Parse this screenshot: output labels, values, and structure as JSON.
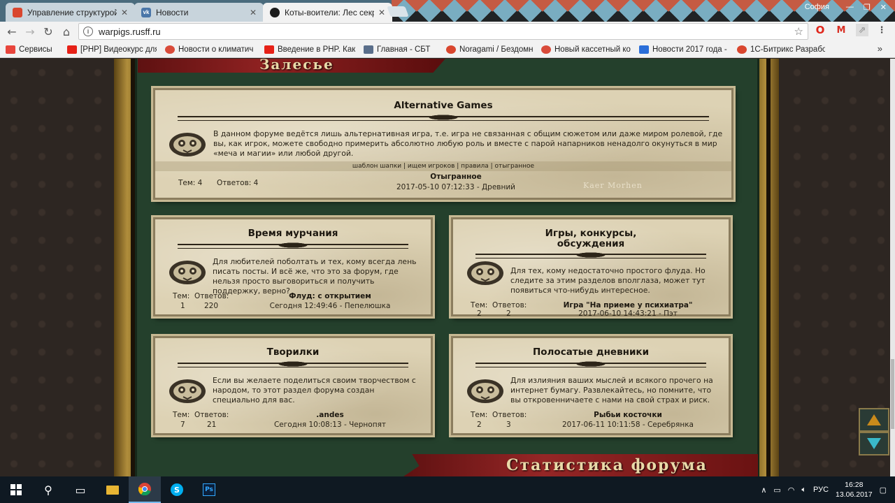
{
  "browser": {
    "tabs": [
      {
        "title": "Управление структурой",
        "favicon_color": "#d9462e"
      },
      {
        "title": "Новости",
        "favicon_color": "#4a76a8"
      },
      {
        "title": "Коты-воители: Лес секр",
        "favicon_color": "#1c1c1c"
      }
    ],
    "user": "София",
    "url": "warpigs.rusff.ru",
    "bookmarks": [
      {
        "label": "Сервисы",
        "color": "#e8453c"
      },
      {
        "label": "[PHP] Видеокурс для",
        "color": "#e62117"
      },
      {
        "label": "Новости о климатич",
        "color": "#d94b3a"
      },
      {
        "label": "Введение в PHP. Как",
        "color": "#e62117"
      },
      {
        "label": "Главная - СБТ",
        "color": "#5a6e8a"
      },
      {
        "label": "Noragami / Бездомн",
        "color": "#d9462e"
      },
      {
        "label": "Новый кассетный ко",
        "color": "#d94b3a"
      },
      {
        "label": "Новости 2017 года -",
        "color": "#2a6ed9"
      },
      {
        "label": "1С-Битрикс Разрабо",
        "color": "#d9462e"
      }
    ],
    "bookmarks_more": "»"
  },
  "page": {
    "top_banner": "Залесье",
    "bottom_banner": "Статистика форума",
    "forums": [
      {
        "title": "Alternative Games",
        "description": "В данном форуме ведётся лишь альтернативная игра, т.е. игра не связанная с общим сюжетом или даже миром ролевой, где вы, как игрок, можете свободно примерить абсолютно любую роль и вместе с парой напарников ненадолго окунуться в мир «меча и магии» или любой другой.",
        "links": "шаблон шапки | ищем игроков | правила | отыгранное",
        "topics_label": "Тем: 4",
        "posts_label": "Ответов: 4",
        "last_title": "Отыгранное",
        "last_info": "2017-05-10 07:12:33 - Древний",
        "watermark": "Kaer Morhen"
      },
      {
        "title": "Время мурчания",
        "description": "Для любителей поболтать и тех, кому всегда лень писать посты. И всё же, что это за форум, где нельзя просто выговориться и получить поддержку, верно?",
        "topics_label": "Тем:",
        "posts_label": "Ответов:",
        "topics": "1",
        "posts": "220",
        "last_title": "Флуд: с открытием",
        "last_info": "Сегодня 12:49:46 - Пепелюшка"
      },
      {
        "title_line1": "Игры, конкурсы,",
        "title_line2": "обсуждения",
        "description": "Для тех, кому недостаточно простого флуда. Но следите за этим разделов вполглаза, может тут появиться что-нибудь интересное.",
        "topics_label": "Тем:",
        "posts_label": "Ответов:",
        "topics": "2",
        "posts": "2",
        "last_title": "Игра \"На приеме у психиатра\"",
        "last_info": "2017-06-10 14:43:21 - Пэт"
      },
      {
        "title": "Творилки",
        "description": "Если вы желаете поделиться своим творчеством с народом, то этот раздел форума создан специально для вас.",
        "topics_label": "Тем:",
        "posts_label": "Ответов:",
        "topics": "7",
        "posts": "21",
        "last_title": ".andes",
        "last_info": "Сегодня 10:08:13 - Чернопят"
      },
      {
        "title": "Полосатые дневники",
        "description": "Для излияния ваших мыслей и всякого прочего на интернет бумагу. Развлекайтесь, но помните, что вы откровенничаете с нами на свой страх и риск.",
        "topics_label": "Тем:",
        "posts_label": "Ответов:",
        "topics": "2",
        "posts": "3",
        "last_title": "Рыбьи косточки",
        "last_info": "2017-06-11 10:11:58 - Серебрянка"
      }
    ]
  },
  "taskbar": {
    "lang": "РУС",
    "time": "16:28",
    "date": "13.06.2017"
  },
  "colors": {
    "card_bg": "#ddd2b4",
    "green_bg": "#24402c",
    "banner_red": "#8e2121"
  }
}
